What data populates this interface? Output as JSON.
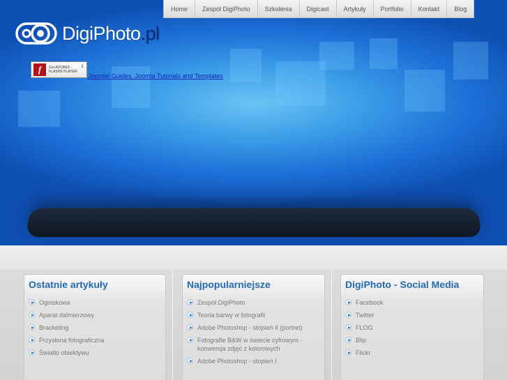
{
  "nav": {
    "items": [
      "Home",
      "Zespół DigiPhoto",
      "Szkolenia",
      "Digicast",
      "Artykuły",
      "Portfolio",
      "Kontakt",
      "Blog"
    ]
  },
  "logo": {
    "name": "DigiPhoto",
    "tld": ".pl"
  },
  "flash": {
    "line1": "Get ADOBE®",
    "line2": "FLASH® PLAYER",
    "icon": "flash-player-icon"
  },
  "joomla_link": "Joomla! Guides, Joomla Tutorials and Templates",
  "panels": [
    {
      "title": "Ostatnie artykuły",
      "items": [
        "Ogniskowa",
        "Aparat dalmierzowy",
        "Bracketing",
        "Przysłona fotograficzna",
        "Światło obiektywu"
      ]
    },
    {
      "title": "Najpopularniejsze",
      "items": [
        "Zespół DigiPhoto",
        "Teoria barwy w fotografii",
        "Adobe Photoshop - stopień II (portret)",
        "Fotografie B&W w świecie cyfrowym - konwersja zdjęć z kolorowych",
        "Adobe Photoshop - stopień I"
      ]
    },
    {
      "title": "DigiPhoto - Social Media",
      "items": [
        "Facebook",
        "Twitter",
        "FLOG",
        "Blip",
        "Flickr"
      ]
    }
  ],
  "colors": {
    "accent": "#2269b7",
    "hero": "#1c6fd6",
    "logo_tld": "#0b2a7a"
  }
}
